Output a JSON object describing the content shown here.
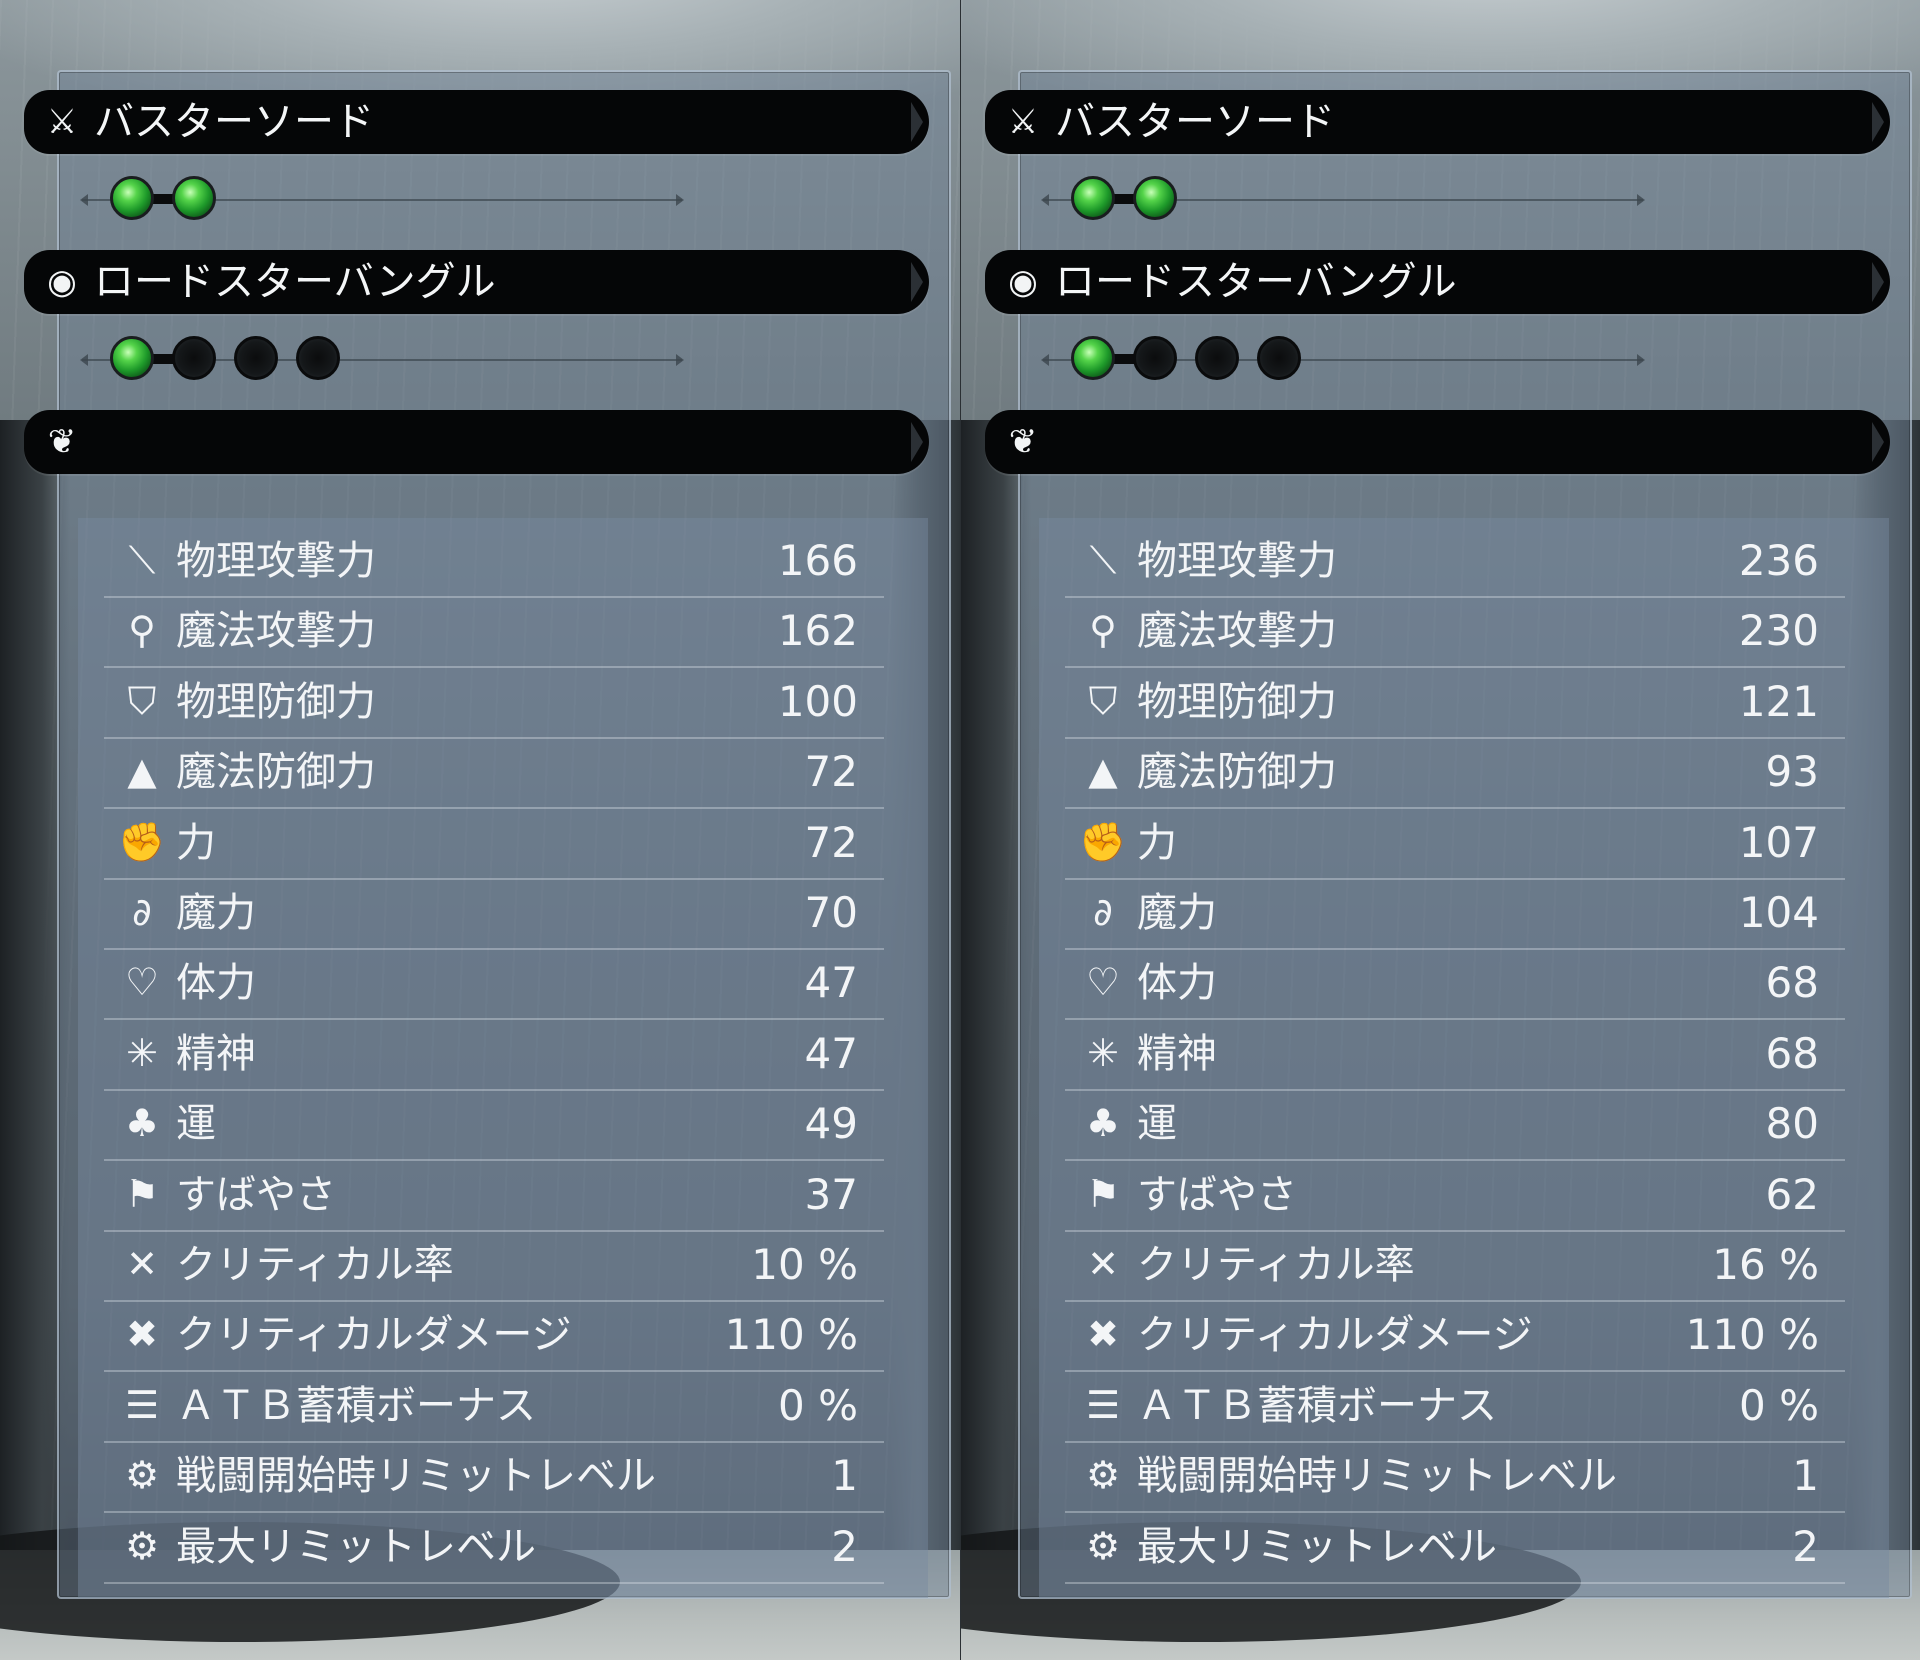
{
  "panels": [
    {
      "weapon": {
        "name": "バスターソード",
        "icon": "sword-icon",
        "materia": [
          true,
          true
        ]
      },
      "armor": {
        "name": "ロードスターバングル",
        "icon": "bangle-icon",
        "materia": [
          true,
          false,
          false,
          false
        ]
      },
      "accessory": {
        "name": "",
        "icon": "necklace-icon"
      },
      "stats": [
        {
          "icon": "sword-slash-icon",
          "glyph": "⟍",
          "label": "物理攻撃力",
          "value": "166"
        },
        {
          "icon": "staff-icon",
          "glyph": "⚲",
          "label": "魔法攻撃力",
          "value": "162"
        },
        {
          "icon": "shield-icon",
          "glyph": "⛉",
          "label": "物理防御力",
          "value": "100"
        },
        {
          "icon": "hat-icon",
          "glyph": "▲",
          "label": "魔法防御力",
          "value": "72"
        },
        {
          "icon": "arm-icon",
          "glyph": "✊",
          "label": "力",
          "value": "72"
        },
        {
          "icon": "spiral-icon",
          "glyph": "∂",
          "label": "魔力",
          "value": "70"
        },
        {
          "icon": "heart-icon",
          "glyph": "♡",
          "label": "体力",
          "value": "47"
        },
        {
          "icon": "sparkle-icon",
          "glyph": "✳",
          "label": "精神",
          "value": "47"
        },
        {
          "icon": "clover-icon",
          "glyph": "♣",
          "label": "運",
          "value": "49"
        },
        {
          "icon": "wing-icon",
          "glyph": "⚑",
          "label": "すばやさ",
          "value": "37"
        },
        {
          "icon": "critical-rate-icon",
          "glyph": "✕",
          "label": "クリティカル率",
          "value": "10 %"
        },
        {
          "icon": "critical-damage-icon",
          "glyph": "✖",
          "label": "クリティカルダメージ",
          "value": "110 %"
        },
        {
          "icon": "atb-icon",
          "glyph": "☰",
          "label": "ＡＴＢ蓄積ボーナス",
          "value": "0 %"
        },
        {
          "icon": "limit-start-icon",
          "glyph": "⚙",
          "label": "戦闘開始時リミットレベル",
          "value": "1"
        },
        {
          "icon": "limit-max-icon",
          "glyph": "⚙",
          "label": "最大リミットレベル",
          "value": "2"
        }
      ]
    },
    {
      "weapon": {
        "name": "バスターソード",
        "icon": "sword-icon",
        "materia": [
          true,
          true
        ]
      },
      "armor": {
        "name": "ロードスターバングル",
        "icon": "bangle-icon",
        "materia": [
          true,
          false,
          false,
          false
        ]
      },
      "accessory": {
        "name": "",
        "icon": "necklace-icon"
      },
      "stats": [
        {
          "icon": "sword-slash-icon",
          "glyph": "⟍",
          "label": "物理攻撃力",
          "value": "236"
        },
        {
          "icon": "staff-icon",
          "glyph": "⚲",
          "label": "魔法攻撃力",
          "value": "230"
        },
        {
          "icon": "shield-icon",
          "glyph": "⛉",
          "label": "物理防御力",
          "value": "121"
        },
        {
          "icon": "hat-icon",
          "glyph": "▲",
          "label": "魔法防御力",
          "value": "93"
        },
        {
          "icon": "arm-icon",
          "glyph": "✊",
          "label": "力",
          "value": "107"
        },
        {
          "icon": "spiral-icon",
          "glyph": "∂",
          "label": "魔力",
          "value": "104"
        },
        {
          "icon": "heart-icon",
          "glyph": "♡",
          "label": "体力",
          "value": "68"
        },
        {
          "icon": "sparkle-icon",
          "glyph": "✳",
          "label": "精神",
          "value": "68"
        },
        {
          "icon": "clover-icon",
          "glyph": "♣",
          "label": "運",
          "value": "80"
        },
        {
          "icon": "wing-icon",
          "glyph": "⚑",
          "label": "すばやさ",
          "value": "62"
        },
        {
          "icon": "critical-rate-icon",
          "glyph": "✕",
          "label": "クリティカル率",
          "value": "16 %"
        },
        {
          "icon": "critical-damage-icon",
          "glyph": "✖",
          "label": "クリティカルダメージ",
          "value": "110 %"
        },
        {
          "icon": "atb-icon",
          "glyph": "☰",
          "label": "ＡＴＢ蓄積ボーナス",
          "value": "0 %"
        },
        {
          "icon": "limit-start-icon",
          "glyph": "⚙",
          "label": "戦闘開始時リミットレベル",
          "value": "1"
        },
        {
          "icon": "limit-max-icon",
          "glyph": "⚙",
          "label": "最大リミットレベル",
          "value": "2"
        }
      ]
    }
  ]
}
